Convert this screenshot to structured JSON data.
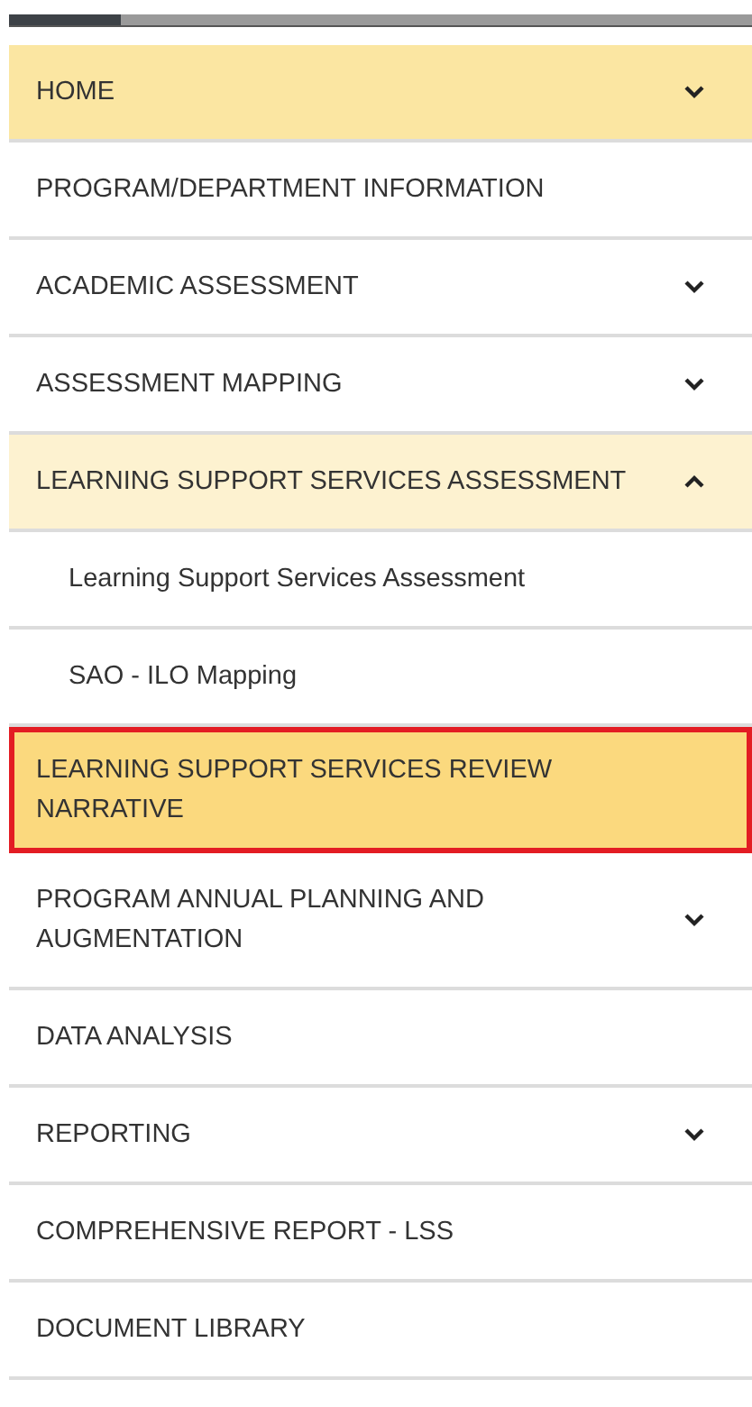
{
  "menu": [
    {
      "label": "HOME",
      "kind": "group",
      "expanded": false,
      "highlighted": true,
      "selected": false
    },
    {
      "label": "PROGRAM/DEPARTMENT INFORMATION",
      "kind": "link",
      "highlighted": false,
      "selected": false
    },
    {
      "label": "ACADEMIC ASSESSMENT",
      "kind": "group",
      "expanded": false,
      "highlighted": false,
      "selected": false
    },
    {
      "label": "ASSESSMENT MAPPING",
      "kind": "group",
      "expanded": false,
      "highlighted": false,
      "selected": false
    },
    {
      "label": "LEARNING SUPPORT SERVICES ASSESSMENT",
      "kind": "group",
      "expanded": true,
      "highlighted": false,
      "selected": false,
      "children": [
        {
          "label": "Learning Support Services Assessment",
          "selected": false
        },
        {
          "label": "SAO - ILO Mapping",
          "selected": false
        }
      ]
    },
    {
      "label": "LEARNING SUPPORT SERVICES REVIEW NARRATIVE",
      "kind": "link",
      "highlighted": false,
      "selected": true
    },
    {
      "label": "PROGRAM ANNUAL PLANNING AND AUGMENTATION",
      "kind": "group",
      "expanded": false,
      "highlighted": false,
      "selected": false
    },
    {
      "label": "DATA ANALYSIS",
      "kind": "link",
      "highlighted": false,
      "selected": false
    },
    {
      "label": "REPORTING",
      "kind": "group",
      "expanded": false,
      "highlighted": false,
      "selected": false
    },
    {
      "label": "COMPREHENSIVE REPORT - LSS",
      "kind": "link",
      "highlighted": false,
      "selected": false
    },
    {
      "label": "DOCUMENT LIBRARY",
      "kind": "link",
      "highlighted": false,
      "selected": false
    }
  ]
}
